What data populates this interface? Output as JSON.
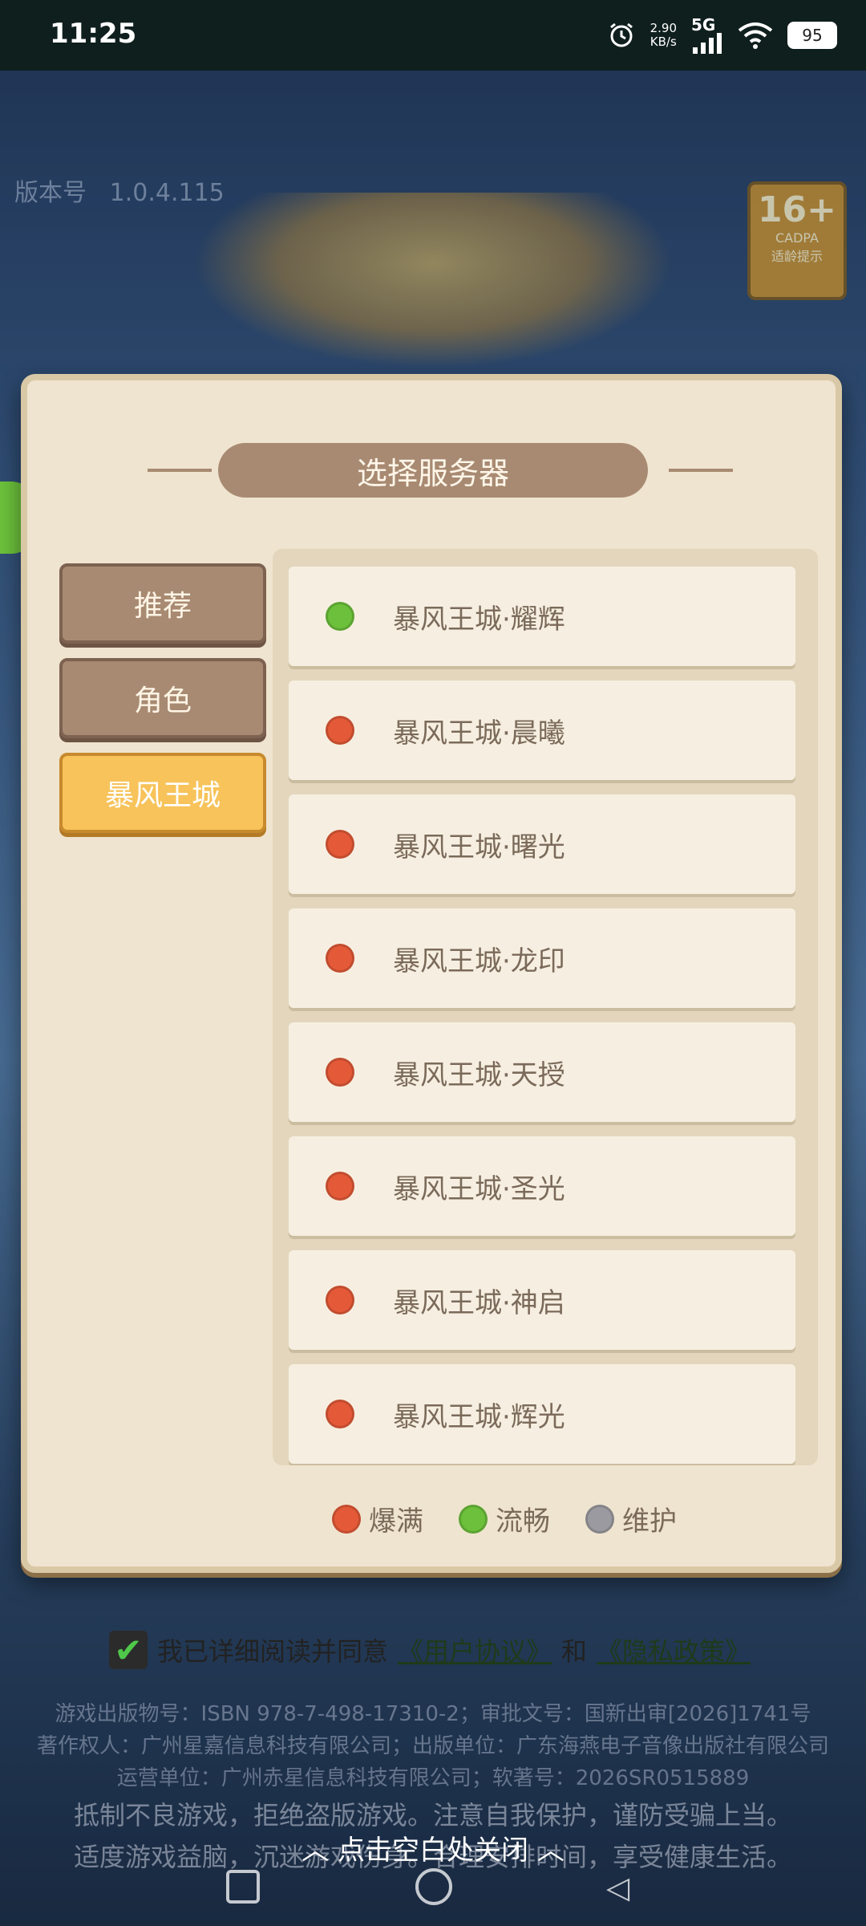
{
  "status_bar": {
    "time": "11:25",
    "net_speed_value": "2.90",
    "net_speed_unit": "KB/s",
    "network": "5G",
    "battery": "95",
    "icons": [
      "alarm-icon",
      "signal-icon",
      "wifi-icon",
      "battery-icon"
    ]
  },
  "background": {
    "version_label": "版本号",
    "version_value": "1.0.4.115",
    "age_rating": {
      "age": "16+",
      "org": "CADPA",
      "note": "适龄提示"
    }
  },
  "dialog": {
    "title": "选择服务器",
    "tabs": [
      {
        "label": "推荐",
        "active": false
      },
      {
        "label": "角色",
        "active": false
      },
      {
        "label": "暴风王城",
        "active": true
      }
    ],
    "servers": [
      {
        "name": "暴风王城·耀辉",
        "status": "green"
      },
      {
        "name": "暴风王城·晨曦",
        "status": "red"
      },
      {
        "name": "暴风王城·曙光",
        "status": "red"
      },
      {
        "name": "暴风王城·龙印",
        "status": "red"
      },
      {
        "name": "暴风王城·天授",
        "status": "red"
      },
      {
        "name": "暴风王城·圣光",
        "status": "red"
      },
      {
        "name": "暴风王城·神启",
        "status": "red"
      },
      {
        "name": "暴风王城·辉光",
        "status": "red"
      }
    ],
    "legend": [
      {
        "label": "爆满",
        "color": "red"
      },
      {
        "label": "流畅",
        "color": "green"
      },
      {
        "label": "维护",
        "color": "gray"
      }
    ]
  },
  "agreement": {
    "prefix": "我已详细阅读并同意",
    "user_agreement": "《用户协议》",
    "and": "和",
    "privacy_policy": "《隐私政策》"
  },
  "footer": {
    "line1": "游戏出版物号：ISBN 978-7-498-17310-2；审批文号：国新出审[2026]1741号",
    "line2": "著作权人：广州星嘉信息科技有限公司；出版单位：广东海燕电子音像出版社有限公司",
    "line3": "运营单位：广州赤星信息科技有限公司；软著号：2026SR0515889",
    "line4": "抵制不良游戏，拒绝盗版游戏。注意自我保护，谨防受骗上当。",
    "line5": "适度游戏益脑，沉迷游戏伤身。合理安排时间，享受健康生活。"
  },
  "close_hint": "点击空白处关闭",
  "colors": {
    "status_red": "#e45a38",
    "status_green": "#6cc03b",
    "status_gray": "#9a9aa0",
    "active_tab": "#f7c35a",
    "inactive_tab": "#a88a72"
  }
}
